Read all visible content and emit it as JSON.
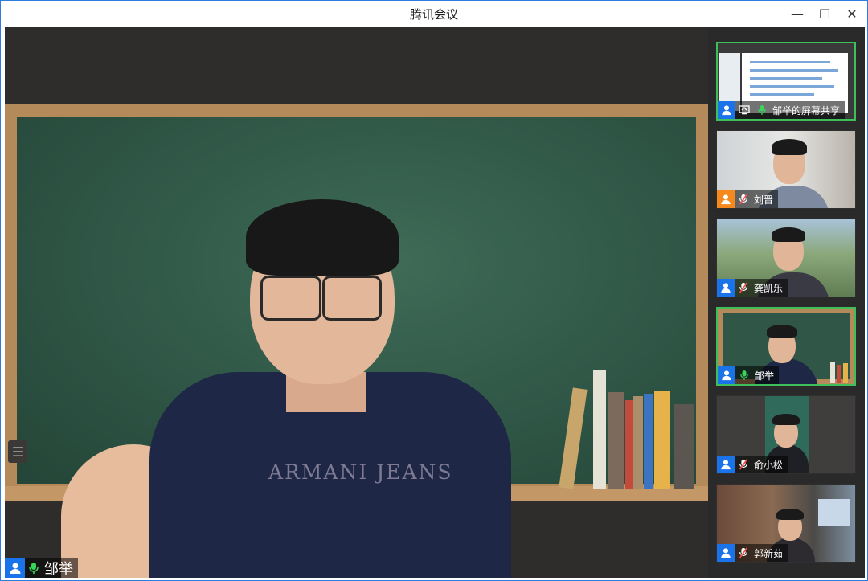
{
  "window": {
    "title": "腾讯会议"
  },
  "window_controls": {
    "minimize": "—",
    "maximize": "☐",
    "close": "✕"
  },
  "main": {
    "speaker_name": "邹举",
    "shirt_text": "ARMANI JEANS",
    "sidebar_toggle_icon": "☰"
  },
  "participants": [
    {
      "name": "邹举的屏幕共享",
      "avatar_color": "#1a73e8",
      "mic": "on",
      "type": "screen-share"
    },
    {
      "name": "刘晋",
      "avatar_color": "#f5891c",
      "mic": "off"
    },
    {
      "name": "龚凯乐",
      "avatar_color": "#1a73e8",
      "mic": "off"
    },
    {
      "name": "邹举",
      "avatar_color": "#1a73e8",
      "mic": "on"
    },
    {
      "name": "俞小松",
      "avatar_color": "#1a73e8",
      "mic": "off"
    },
    {
      "name": "郭新茹",
      "avatar_color": "#1a73e8",
      "mic": "off"
    }
  ],
  "icons": {
    "avatar": "person-icon",
    "mic_on": "mic-icon",
    "mic_off": "mic-muted-icon"
  }
}
